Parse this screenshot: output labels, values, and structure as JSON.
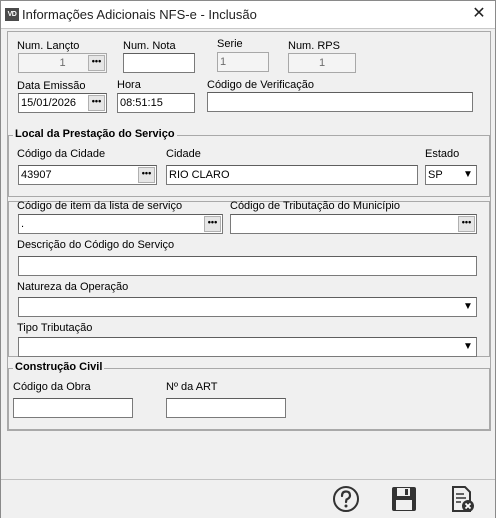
{
  "window": {
    "app_icon_text": "VD",
    "title": "Informações Adicionais NFS-e - Inclusão",
    "close_symbol": "✕"
  },
  "header": {
    "num_lancto": {
      "label": "Num. Lançto",
      "value": "1"
    },
    "num_nota": {
      "label": "Num. Nota",
      "value": ""
    },
    "serie": {
      "label": "Serie",
      "value": "1"
    },
    "num_rps": {
      "label": "Num. RPS",
      "value": "1"
    },
    "data_emissao": {
      "label": "Data Emissão",
      "value": "15/01/2026"
    },
    "hora": {
      "label": "Hora",
      "value": "08:51:15"
    },
    "codigo_verificacao": {
      "label": "Código de Verificação",
      "value": ""
    }
  },
  "local": {
    "title": "Local da Prestação do Serviço",
    "codigo_cidade": {
      "label": "Código da Cidade",
      "value": "43907"
    },
    "cidade": {
      "label": "Cidade",
      "value": "RIO CLARO"
    },
    "estado": {
      "label": "Estado",
      "value": "SP"
    }
  },
  "servico": {
    "codigo_item": {
      "label": "Código de item da lista de serviço",
      "value": "."
    },
    "codigo_tributacao": {
      "label": "Código de Tributação do Município",
      "value": ""
    },
    "descricao": {
      "label": "Descrição do Código do Serviço",
      "value": ""
    },
    "natureza": {
      "label": "Natureza da Operação",
      "value": ""
    },
    "tipo_tributacao": {
      "label": "Tipo Tributação",
      "value": ""
    }
  },
  "construcao": {
    "title": "Construção Civil",
    "codigo_obra": {
      "label": "Código da Obra",
      "value": ""
    },
    "num_art": {
      "label": "Nº da ART",
      "value": ""
    }
  },
  "common": {
    "ellipsis": "•••",
    "dropdown_arrow": "▼"
  },
  "toolbar": {
    "icons": [
      "help-icon",
      "save-icon",
      "cancel-icon"
    ]
  }
}
